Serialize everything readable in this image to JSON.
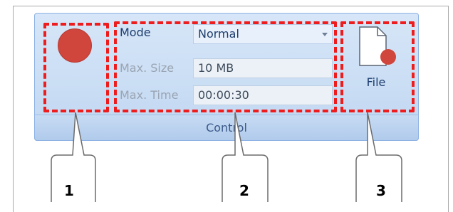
{
  "ribbon_group": {
    "title": "Control"
  },
  "record_button": {
    "icon": "record-circle-icon",
    "color": "#d0453c"
  },
  "settings": {
    "mode": {
      "label": "Mode",
      "value": "Normal"
    },
    "max_size": {
      "label": "Max. Size",
      "value": "10 MB"
    },
    "max_time": {
      "label": "Max. Time",
      "value": "00:00:30"
    }
  },
  "file_button": {
    "label": "File",
    "icon": "document-record-icon"
  },
  "annotations": {
    "highlight_color": "#ee1c1c",
    "callouts": [
      "1",
      "2",
      "3"
    ]
  }
}
